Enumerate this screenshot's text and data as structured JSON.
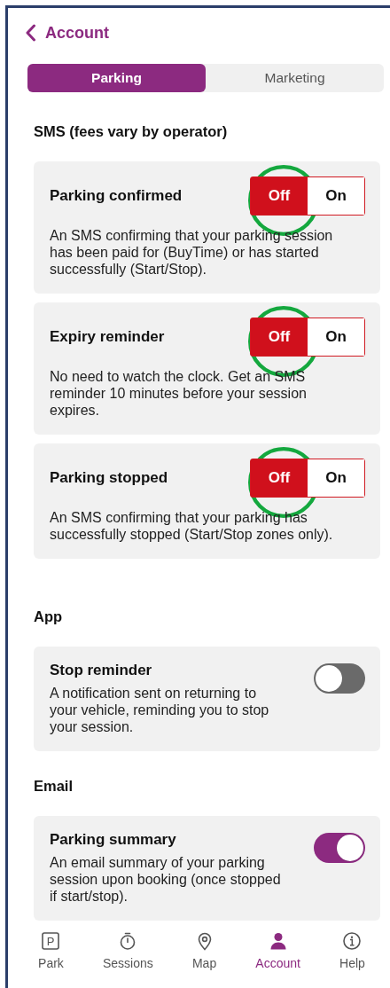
{
  "header": {
    "back_label": "Account"
  },
  "tabs": [
    {
      "label": "Parking",
      "selected": true
    },
    {
      "label": "Marketing",
      "selected": false
    }
  ],
  "sections": [
    {
      "heading": "SMS (fees vary by operator)",
      "items": [
        {
          "kind": "segmented",
          "title": "Parking confirmed",
          "description": "An SMS confirming that your parking session has been paid for (BuyTime) or has started successfully (Start/Stop).",
          "on": false,
          "off_label": "Off",
          "on_label": "On",
          "highlighted": true
        },
        {
          "kind": "segmented",
          "title": "Expiry reminder",
          "description": "No need to watch the clock. Get an SMS reminder 10 minutes before your session expires.",
          "on": false,
          "off_label": "Off",
          "on_label": "On",
          "highlighted": true
        },
        {
          "kind": "segmented",
          "title": "Parking stopped",
          "description": "An SMS confirming that your parking has successfully stopped (Start/Stop zones only).",
          "on": false,
          "off_label": "Off",
          "on_label": "On",
          "highlighted": true
        }
      ]
    },
    {
      "heading": "App",
      "items": [
        {
          "kind": "switch",
          "title": "Stop reminder",
          "description": "A notification sent on returning to your vehicle, reminding you to stop your session.",
          "on": false
        }
      ]
    },
    {
      "heading": "Email",
      "items": [
        {
          "kind": "switch",
          "title": "Parking summary",
          "description": "An email summary of your parking session upon booking (once stopped if start/stop).",
          "on": true
        }
      ]
    }
  ],
  "nav": [
    {
      "label": "Park",
      "icon_text": "P",
      "selected": false
    },
    {
      "label": "Sessions",
      "selected": false
    },
    {
      "label": "Map",
      "selected": false
    },
    {
      "label": "Account",
      "selected": true
    },
    {
      "label": "Help",
      "selected": false
    }
  ]
}
